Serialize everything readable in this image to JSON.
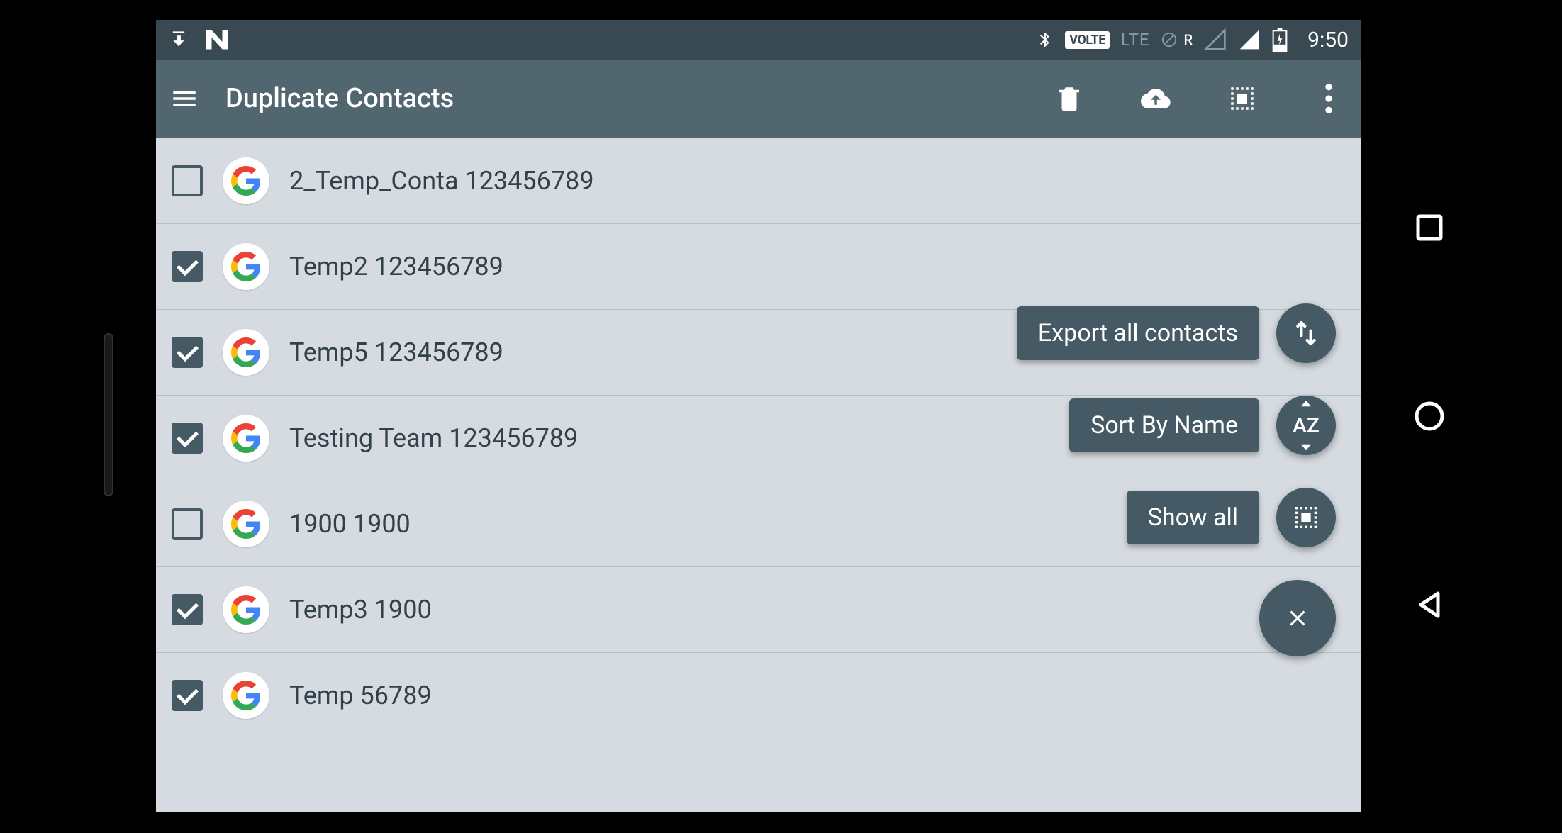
{
  "status": {
    "time": "9:50",
    "volte": "VOLTE",
    "lte": "LTE",
    "roaming": "R"
  },
  "appbar": {
    "title": "Duplicate Contacts"
  },
  "contacts": [
    {
      "checked": false,
      "label": "2_Temp_Conta 123456789"
    },
    {
      "checked": true,
      "label": "Temp2 123456789"
    },
    {
      "checked": true,
      "label": "Temp5 123456789"
    },
    {
      "checked": true,
      "label": "Testing Team 123456789"
    },
    {
      "checked": false,
      "label": "1900 1900"
    },
    {
      "checked": true,
      "label": "Temp3 1900"
    },
    {
      "checked": true,
      "label": "Temp 56789"
    }
  ],
  "fab": {
    "export": "Export all contacts",
    "sort": "Sort By Name",
    "showall": "Show all",
    "sort_icon_text": "AZ"
  }
}
